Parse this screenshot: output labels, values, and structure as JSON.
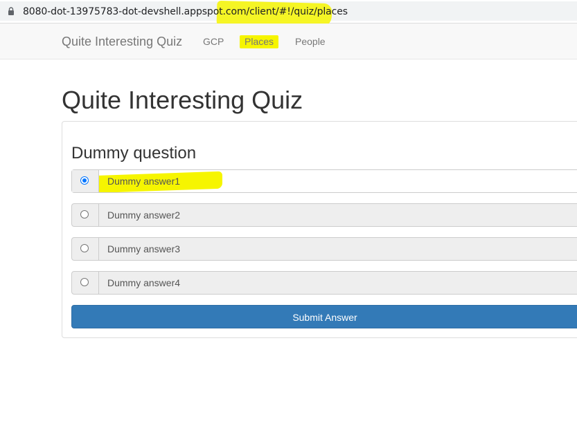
{
  "address_bar": {
    "url": "8080-dot-13975783-dot-devshell.appspot.com/client/#!/quiz/places"
  },
  "navbar": {
    "brand": "Quite Interesting Quiz",
    "links": [
      "GCP",
      "Places",
      "People"
    ],
    "active": "Places"
  },
  "main": {
    "title": "Quite Interesting Quiz",
    "question": "Dummy question",
    "answers": [
      {
        "label": "Dummy answer1",
        "selected": true
      },
      {
        "label": "Dummy answer2",
        "selected": false
      },
      {
        "label": "Dummy answer3",
        "selected": false
      },
      {
        "label": "Dummy answer4",
        "selected": false
      }
    ],
    "submit_label": "Submit Answer"
  },
  "colors": {
    "highlight": "#f6f500",
    "primary_button": "#337ab7",
    "navbar_bg": "#f8f8f8",
    "radio_checked": "#0075ff"
  }
}
